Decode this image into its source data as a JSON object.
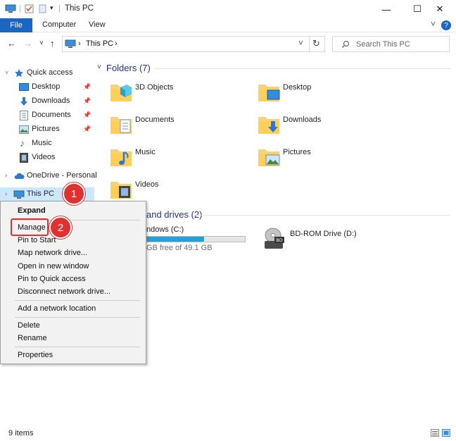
{
  "window": {
    "title": "This PC",
    "minimize": "—",
    "maximize": "☐",
    "close": "✕"
  },
  "ribbon": {
    "file": "File",
    "tabs": [
      "Computer",
      "View"
    ],
    "expand": "˅",
    "help": "?"
  },
  "nav": {
    "back": "←",
    "forward": "→",
    "recent": "˅",
    "up": "↑"
  },
  "address": {
    "sep1": "›",
    "location": "This PC",
    "sep2": "›",
    "dropdown": "˅",
    "refresh": "↻"
  },
  "search": {
    "placeholder": "Search This PC"
  },
  "sidebar": {
    "quick_access": "Quick access",
    "items": [
      "Desktop",
      "Downloads",
      "Documents",
      "Pictures",
      "Music",
      "Videos"
    ],
    "onedrive": "OneDrive - Personal",
    "this_pc": "This PC"
  },
  "folders": {
    "heading": "Folders (7)",
    "items": [
      "3D Objects",
      "Desktop",
      "Documents",
      "Downloads",
      "Music",
      "Pictures",
      "Videos"
    ]
  },
  "drives": {
    "heading": "and drives (2)",
    "c_name": "ndows (C:)",
    "c_free": "GB free of 49.1 GB",
    "c_used_fraction": 0.58,
    "d_name": "BD-ROM Drive (D:)",
    "d_badge": "BD"
  },
  "context_menu": {
    "items": [
      "Expand",
      "Manage",
      "Pin to Start",
      "Map network drive...",
      "Open in new window",
      "Pin to Quick access",
      "Disconnect network drive...",
      "Add a network location",
      "Delete",
      "Rename",
      "Properties"
    ]
  },
  "callouts": [
    "1",
    "2"
  ],
  "status": {
    "items_count": "9 items"
  },
  "colors": {
    "accent": "#1a66c2",
    "selection": "#cce8ff",
    "callout": "#e0312f",
    "heading": "#1e3287",
    "drive_fill": "#26a0da"
  }
}
